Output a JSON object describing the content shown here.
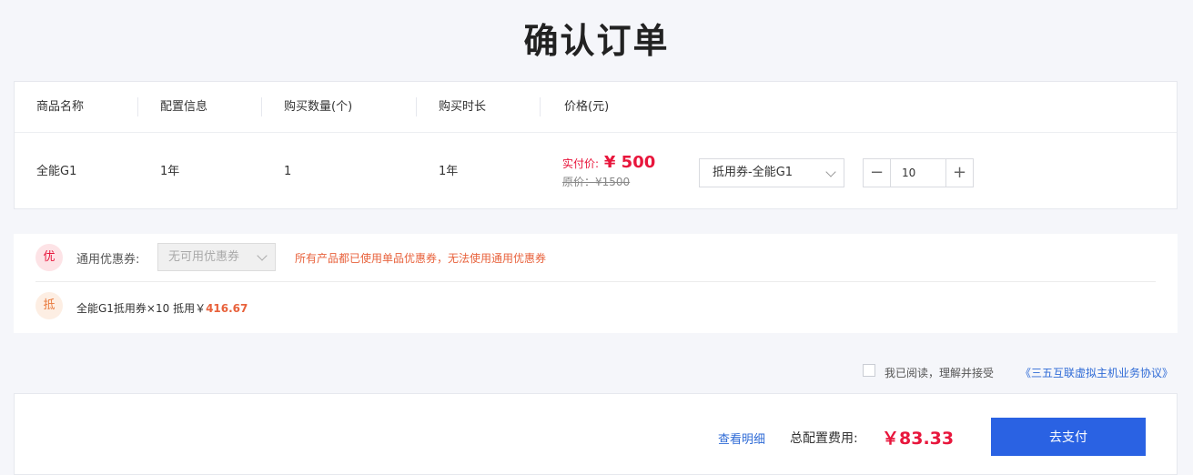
{
  "page": {
    "title": "确认订单"
  },
  "table": {
    "headers": [
      "商品名称",
      "配置信息",
      "购买数量(个)",
      "购买时长",
      "价格(元)"
    ],
    "row": {
      "product": "全能G1",
      "config": "1年",
      "quantity": "1",
      "duration": "1年",
      "price_real_label": "实付价:",
      "price_real_value": "¥ 500",
      "price_orig": "原价：¥1500",
      "voucher_selected": "抵用券-全能G1",
      "stepper_value": "10",
      "stepper_minus": "−",
      "stepper_plus": "+"
    }
  },
  "coupons": {
    "badge_you": "优",
    "label": "通用优惠券:",
    "select_value": "无可用优惠券",
    "warning": "所有产品都已使用单品优惠券，无法使用通用优惠券",
    "badge_di": "抵",
    "deduct_text": "全能G1抵用券×10   抵用￥",
    "deduct_amount": "416.67"
  },
  "agreement": {
    "text": "我已阅读，理解并接受",
    "link": "《三五互联虚拟主机业务协议》"
  },
  "footer": {
    "detail_link": "查看明细",
    "total_label": "总配置费用:",
    "total_value": "￥83.33",
    "pay_button": "去支付"
  },
  "colors": {
    "accent_red": "#e8163c",
    "accent_orange": "#e8623c",
    "primary_blue": "#2a62e3",
    "link_blue": "#2f6bd6"
  }
}
